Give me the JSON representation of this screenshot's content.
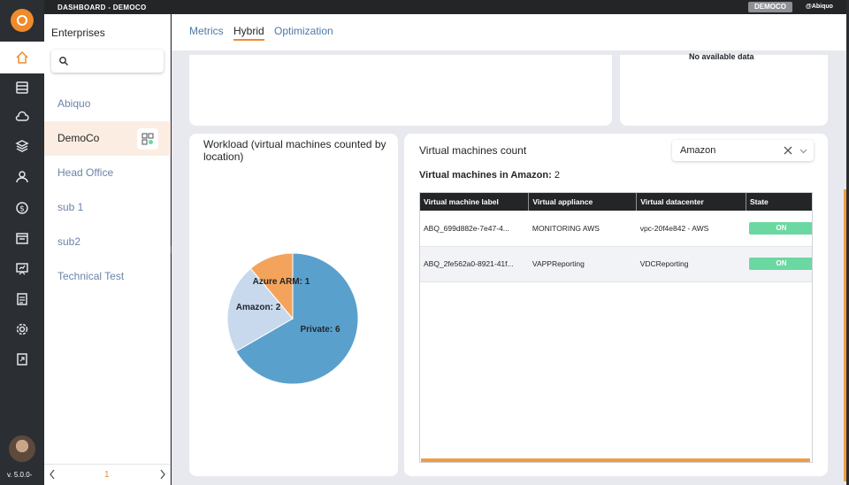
{
  "topbar": {
    "title": "DASHBOARD - DEMOCO",
    "enterprise_badge": "DEMOCO",
    "user": "@Abiquo"
  },
  "leftnav": {
    "items": [
      "home-icon",
      "storage-icon",
      "cloud-icon",
      "layers-icon",
      "user-icon",
      "billing-icon",
      "calendar-icon",
      "monitor-icon",
      "document-icon",
      "settings-icon",
      "export-icon"
    ],
    "version": "v. 5.0.0-"
  },
  "enterprises": {
    "heading": "Enterprises",
    "search_placeholder": "",
    "items": [
      {
        "label": "Abiquo",
        "active": false
      },
      {
        "label": "DemoCo",
        "active": true
      },
      {
        "label": "Head Office",
        "active": false
      },
      {
        "label": "sub 1",
        "active": false
      },
      {
        "label": "sub2",
        "active": false
      },
      {
        "label": "Technical Test",
        "active": false
      }
    ],
    "pager": {
      "current": "1"
    }
  },
  "tabs": [
    {
      "label": "Metrics",
      "active": false
    },
    {
      "label": "Hybrid",
      "active": true
    },
    {
      "label": "Optimization",
      "active": false
    }
  ],
  "top_card_right": {
    "text": "No available data"
  },
  "workload": {
    "title": "Workload (virtual machines counted by location)",
    "chart_data": {
      "type": "pie",
      "categories": [
        "Private",
        "Amazon",
        "Azure ARM"
      ],
      "values": [
        6,
        2,
        1
      ],
      "labels": [
        "Private: 6",
        "Amazon: 2",
        "Azure ARM: 1"
      ],
      "colors": [
        "#5aa0cc",
        "#c8d9ee",
        "#f4a35c"
      ]
    }
  },
  "vm_panel": {
    "title": "Virtual machines count",
    "provider_selected": "Amazon",
    "count_label": "Virtual machines in Amazon:",
    "count_value": "2",
    "columns": [
      "Virtual machine label",
      "Virtual appliance",
      "Virtual datacenter",
      "State"
    ],
    "rows": [
      {
        "label": "ABQ_699d882e-7e47-4...",
        "appliance": "MONITORING AWS",
        "datacenter": "vpc-20f4e842 - AWS",
        "state": "ON"
      },
      {
        "label": "ABQ_2fe562a0-8921-41f...",
        "appliance": "VAPPReporting",
        "datacenter": "VDCReporting",
        "state": "ON"
      }
    ]
  }
}
